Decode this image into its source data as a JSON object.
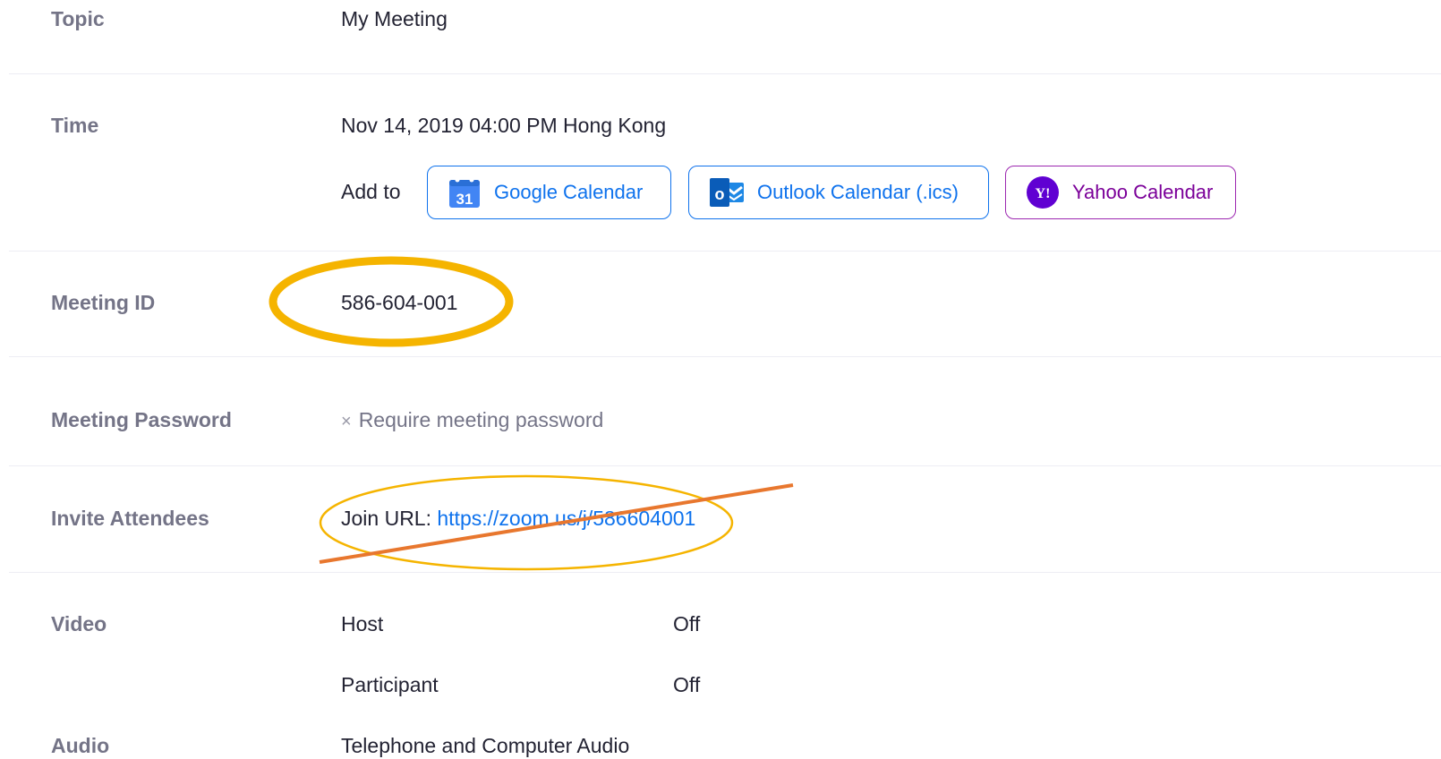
{
  "topic": {
    "label": "Topic",
    "value": "My Meeting"
  },
  "time": {
    "label": "Time",
    "value": "Nov 14, 2019 04:00 PM Hong Kong",
    "add_to_label": "Add to",
    "calendars": [
      {
        "label": "Google Calendar",
        "icon": "google-calendar-icon",
        "icon_text": "31",
        "color": "#0e72ed"
      },
      {
        "label": "Outlook Calendar (.ics)",
        "icon": "outlook-calendar-icon",
        "icon_text": "o",
        "color": "#0e72ed"
      },
      {
        "label": "Yahoo Calendar",
        "icon": "yahoo-calendar-icon",
        "icon_text": "Y!",
        "color": "#7b0099"
      }
    ]
  },
  "meeting_id": {
    "label": "Meeting ID",
    "value": "586-604-001"
  },
  "meeting_password": {
    "label": "Meeting Password",
    "value": "Require meeting password",
    "icon": "x-icon"
  },
  "invite_attendees": {
    "label": "Invite Attendees",
    "join_url_label": "Join URL:",
    "join_url": "https://zoom.us/j/586604001"
  },
  "video": {
    "label": "Video",
    "host_label": "Host",
    "host_value": "Off",
    "participant_label": "Participant",
    "participant_value": "Off"
  },
  "audio": {
    "label": "Audio",
    "value": "Telephone and Computer Audio"
  },
  "colors": {
    "accent": "#0e72ed",
    "yahoo": "#7b0099",
    "annotation_circle": "#f5b400",
    "annotation_strike": "#e8772e"
  }
}
